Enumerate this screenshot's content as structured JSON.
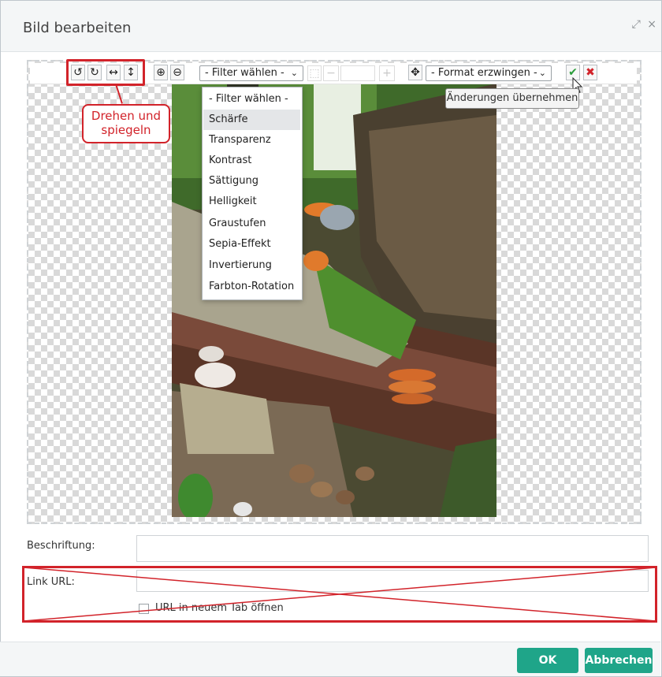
{
  "dialog": {
    "title": "Bild bearbeiten",
    "expand_glyph": "⤢",
    "close_glyph": "×"
  },
  "toolbar": {
    "buttons": [
      {
        "name": "rotate-left-icon",
        "glyph": "↺"
      },
      {
        "name": "rotate-right-icon",
        "glyph": "↻"
      },
      {
        "name": "flip-horizontal-icon",
        "glyph": "↔"
      },
      {
        "name": "flip-vertical-icon",
        "glyph": "↕"
      },
      {
        "name": "zoom-in-icon",
        "glyph": "⊕"
      },
      {
        "name": "zoom-out-icon",
        "glyph": "⊖"
      }
    ],
    "filter_select": "- Filter wählen -",
    "format_select": "- Format erzwingen -",
    "move_glyph": "✥",
    "minus_glyph": "−",
    "plus_glyph": "+",
    "crop_glyph": "⬚",
    "confirm_glyph": "✔",
    "cancel_glyph": "✖",
    "confirm_color": "#2a9d3a",
    "cancel_color": "#d2232a"
  },
  "callout": {
    "line1": "Drehen und",
    "line2": "spiegeln"
  },
  "tooltip": "Änderungen übernehmen",
  "filter_options": [
    "- Filter wählen -",
    "Schärfe",
    "Transparenz",
    "Kontrast",
    "Sättigung",
    "Helligkeit",
    "Graustufen",
    "Sepia-Effekt",
    "Invertierung",
    "Farbton-Rotation"
  ],
  "filter_highlighted": "Schärfe",
  "form": {
    "caption_label": "Beschriftung:",
    "caption_value": "",
    "link_label": "Link URL:",
    "link_value": "",
    "new_tab_label": "URL in neuem Tab öffnen",
    "new_tab_checked": false
  },
  "footer": {
    "ok_label": "OK",
    "cancel_label": "Abbrechen",
    "button_color": "#1fa589"
  },
  "colors": {
    "annotation_red": "#d2232a"
  }
}
